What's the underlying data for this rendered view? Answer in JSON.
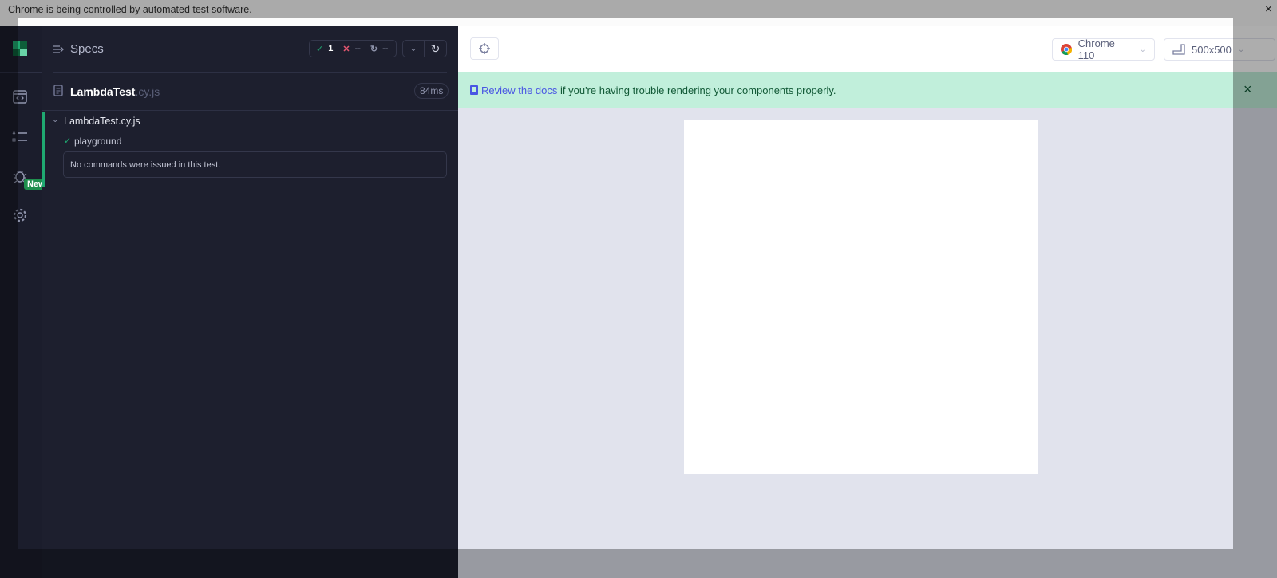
{
  "infobar": {
    "message": "Chrome is being controlled by automated test software.",
    "close": "×"
  },
  "sidebar": {
    "new_badge": "New",
    "icons": [
      "cypress-logo-icon",
      "runner-icon",
      "specs-list-icon",
      "debug-bug-icon",
      "settings-gear-icon"
    ]
  },
  "specs_panel": {
    "title": "Specs",
    "stats": {
      "passed": "1",
      "failed": "--",
      "pending": "--"
    },
    "spec": {
      "name": "LambdaTest",
      "ext": ".cy.js",
      "duration": "84ms"
    },
    "suite": {
      "title": "LambdaTest.cy.js",
      "test": "playground",
      "empty_message": "No commands were issued in this test."
    }
  },
  "preview": {
    "browser": "Chrome 110",
    "viewport": "500x500",
    "banner": {
      "link": "Review the docs",
      "text": " if you're having trouble rendering your components properly.",
      "close": "×"
    },
    "colors": {
      "banner_bg": "#c1efdb",
      "link": "#4956e3",
      "pass": "#1fa971",
      "fail": "#e45770"
    }
  }
}
